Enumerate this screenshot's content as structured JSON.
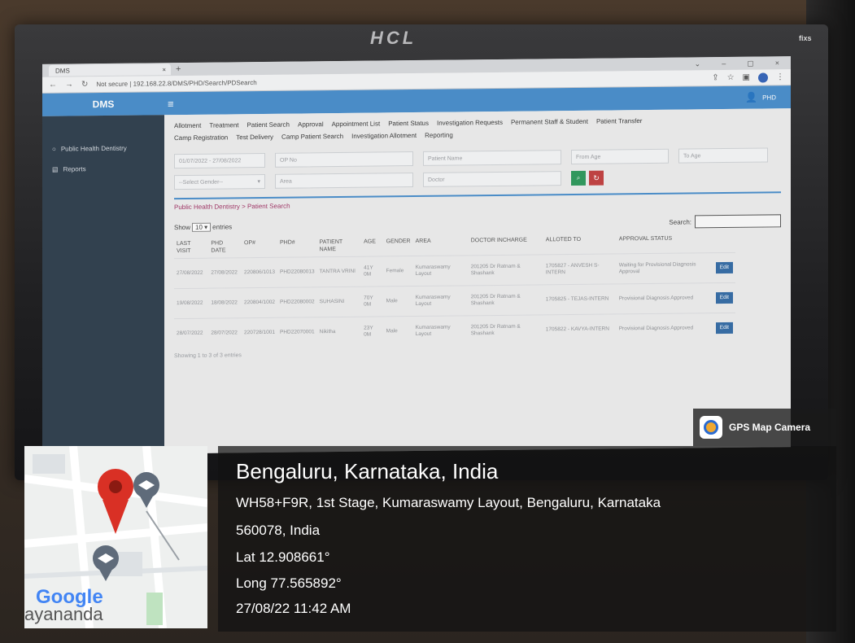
{
  "photo": {
    "monitor_brand": "HCL",
    "monitor_corner_label": "fixs"
  },
  "browser": {
    "tab_title": "DMS",
    "url": "Not secure | 192.168.22.8/DMS/PHD/Search/PDSearch"
  },
  "app": {
    "brand": "DMS",
    "user": "PHD",
    "sidebar": [
      {
        "icon": "circle-icon",
        "label": "Public Health Dentistry"
      },
      {
        "icon": "report-icon",
        "label": "Reports"
      }
    ],
    "menu_row1": [
      "Allotment",
      "Treatment",
      "Patient Search",
      "Approval",
      "Appointment List",
      "Patient Status",
      "Investigation Requests",
      "Permanent Staff & Student",
      "Patient Transfer"
    ],
    "menu_row2": [
      "Camp Registration",
      "Test Delivery",
      "Camp Patient Search",
      "Investigation Allotment",
      "Reporting"
    ],
    "filters": {
      "date_range": "01/07/2022 - 27/08/2022",
      "op_no": "OP No",
      "patient_name": "Patient Name",
      "from_age": "From Age",
      "to_age": "To Age",
      "gender": "--Select Gender--",
      "area": "Area",
      "doctor": "Doctor"
    },
    "breadcrumb": "Public Health Dentistry > Patient Search",
    "show_label": "Show",
    "entries_value": "10",
    "entries_label": "entries",
    "search_label": "Search:",
    "columns": [
      "LAST VISIT",
      "PhD DATE",
      "OP#",
      "PHD#",
      "PATIENT NAME",
      "AGE",
      "GENDER",
      "AREA",
      "DOCTOR INCHARGE",
      "ALLOTED TO",
      "APPROVAL STATUS",
      ""
    ],
    "rows": [
      {
        "last_visit": "27/08/2022",
        "phd_date": "27/08/2022",
        "op": "220806/1013",
        "phd": "PHD22080013",
        "name": "TANTRA VRINI",
        "age": "41Y 0M",
        "gender": "Female",
        "area": "Kumaraswamy Layout",
        "doctor": "201205 Dr Ratnam & Shashank",
        "alloted": "1705827 - ANVESH S-INTERN",
        "status": "Waiting for Provisional Diagnosis Approval",
        "action": "Edit"
      },
      {
        "last_visit": "19/08/2022",
        "phd_date": "18/08/2022",
        "op": "220804/1002",
        "phd": "PHD22080002",
        "name": "SUHASINI",
        "age": "70Y 0M",
        "gender": "Male",
        "area": "Kumaraswamy Layout",
        "doctor": "201205 Dr Ratnam & Shashank",
        "alloted": "1705825 - TEJAS-INTERN",
        "status": "Provisional Diagnosis Approved",
        "action": "Edit"
      },
      {
        "last_visit": "28/07/2022",
        "phd_date": "28/07/2022",
        "op": "220728/1001",
        "phd": "PHD22070001",
        "name": "Nikitha",
        "age": "23Y 0M",
        "gender": "Male",
        "area": "Kumaraswamy Layout",
        "doctor": "201205 Dr Ratnam & Shashank",
        "alloted": "1705822 - KAVYA-INTERN",
        "status": "Provisional Diagnosis Approved",
        "action": "Edit"
      }
    ],
    "showing": "Showing 1 to 3 of 3 entries"
  },
  "geotag": {
    "app_name": "GPS Map Camera",
    "city": "Bengaluru, Karnataka, India",
    "address_line1": "WH58+F9R, 1st Stage, Kumaraswamy Layout, Bengaluru, Karnataka",
    "address_line2": "560078, India",
    "lat": "Lat 12.908661°",
    "long": "Long 77.565892°",
    "datetime": "27/08/22 11:42 AM",
    "map_brand": "Google",
    "map_place": "ayanandа"
  }
}
